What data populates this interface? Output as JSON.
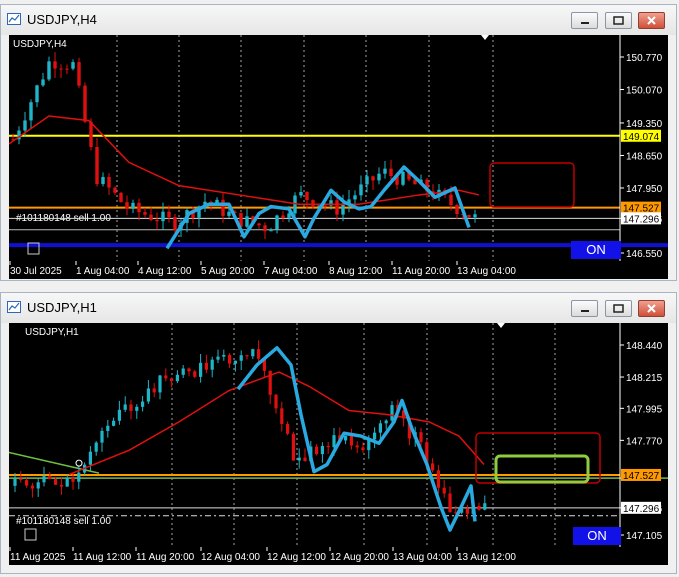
{
  "windows": [
    {
      "title": "USDJPY,H4",
      "chart_label": "USDJPY,H4",
      "order_label": "#101180148 sell 1.00",
      "price_ticks": [
        "150.770",
        "150.070",
        "149.350",
        "148.650",
        "147.950",
        "147.296",
        "146.550"
      ],
      "price_badges": [
        {
          "text": "149.074",
          "color": "#ffff00"
        },
        {
          "text": "147.527",
          "color": "#ff9900"
        },
        {
          "text": "147.296",
          "color": "#ffffff"
        }
      ],
      "time_ticks": [
        "30 Jul 2025",
        "1 Aug 04:00",
        "4 Aug 12:00",
        "5 Aug 20:00",
        "7 Aug 04:00",
        "8 Aug 12:00",
        "11 Aug 20:00",
        "13 Aug 04:00"
      ],
      "on_badge": "ON"
    },
    {
      "title": "USDJPY,H1",
      "chart_label": "USDJPY,H1",
      "order_label": "#101180148 sell 1.00",
      "price_ticks": [
        "148.440",
        "148.215",
        "147.995",
        "147.770",
        "147.296",
        "147.105"
      ],
      "price_badges": [
        {
          "text": "147.527",
          "color": "#ff9900"
        },
        {
          "text": "147.296",
          "color": "#ffffff"
        }
      ],
      "time_ticks": [
        "11 Aug 2025",
        "11 Aug 12:00",
        "11 Aug 20:00",
        "12 Aug 04:00",
        "12 Aug 12:00",
        "12 Aug 20:00",
        "13 Aug 04:00",
        "13 Aug 12:00"
      ],
      "on_badge": "ON"
    }
  ],
  "colors": {
    "bull": "#1fb5c8",
    "bear": "#e01010",
    "ma": "#e01010",
    "trace": "#29a9e0",
    "line_yellow": "#ffff00",
    "line_orange": "#ff9900",
    "line_blue": "#1010d0",
    "box_red": "#c00000",
    "box_green": "#8fcc40",
    "on_bg": "#1212e8"
  }
}
